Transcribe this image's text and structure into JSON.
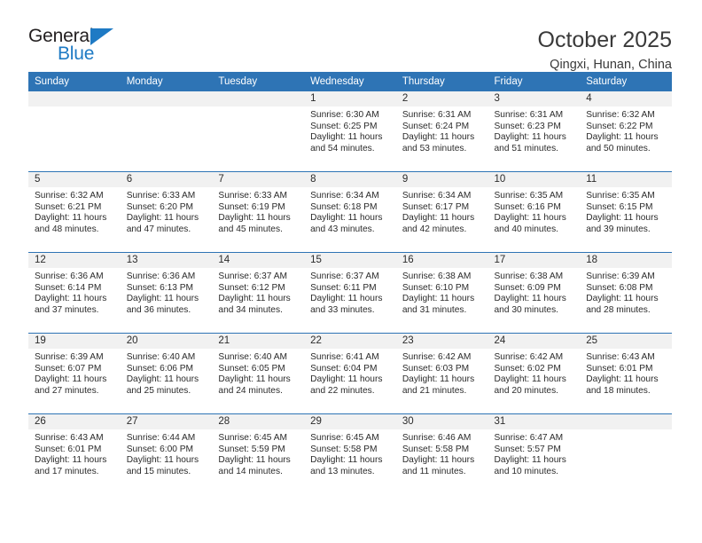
{
  "brand": {
    "name_part1": "General",
    "name_part2": "Blue",
    "triangle_icon": "blue-triangle-icon",
    "accent_color": "#1e7ac4"
  },
  "header": {
    "title": "October 2025",
    "subtitle": "Qingxi, Hunan, China",
    "header_bg_color": "#2e74b5",
    "daynum_bg_color": "#f1f1f1"
  },
  "weekday_headers": [
    "Sunday",
    "Monday",
    "Tuesday",
    "Wednesday",
    "Thursday",
    "Friday",
    "Saturday"
  ],
  "weeks": [
    [
      {
        "day": "",
        "blank": true
      },
      {
        "day": "",
        "blank": true
      },
      {
        "day": "",
        "blank": true
      },
      {
        "day": "1",
        "sunrise": "Sunrise: 6:30 AM",
        "sunset": "Sunset: 6:25 PM",
        "daylight1": "Daylight: 11 hours",
        "daylight2": "and 54 minutes."
      },
      {
        "day": "2",
        "sunrise": "Sunrise: 6:31 AM",
        "sunset": "Sunset: 6:24 PM",
        "daylight1": "Daylight: 11 hours",
        "daylight2": "and 53 minutes."
      },
      {
        "day": "3",
        "sunrise": "Sunrise: 6:31 AM",
        "sunset": "Sunset: 6:23 PM",
        "daylight1": "Daylight: 11 hours",
        "daylight2": "and 51 minutes."
      },
      {
        "day": "4",
        "sunrise": "Sunrise: 6:32 AM",
        "sunset": "Sunset: 6:22 PM",
        "daylight1": "Daylight: 11 hours",
        "daylight2": "and 50 minutes."
      }
    ],
    [
      {
        "day": "5",
        "sunrise": "Sunrise: 6:32 AM",
        "sunset": "Sunset: 6:21 PM",
        "daylight1": "Daylight: 11 hours",
        "daylight2": "and 48 minutes."
      },
      {
        "day": "6",
        "sunrise": "Sunrise: 6:33 AM",
        "sunset": "Sunset: 6:20 PM",
        "daylight1": "Daylight: 11 hours",
        "daylight2": "and 47 minutes."
      },
      {
        "day": "7",
        "sunrise": "Sunrise: 6:33 AM",
        "sunset": "Sunset: 6:19 PM",
        "daylight1": "Daylight: 11 hours",
        "daylight2": "and 45 minutes."
      },
      {
        "day": "8",
        "sunrise": "Sunrise: 6:34 AM",
        "sunset": "Sunset: 6:18 PM",
        "daylight1": "Daylight: 11 hours",
        "daylight2": "and 43 minutes."
      },
      {
        "day": "9",
        "sunrise": "Sunrise: 6:34 AM",
        "sunset": "Sunset: 6:17 PM",
        "daylight1": "Daylight: 11 hours",
        "daylight2": "and 42 minutes."
      },
      {
        "day": "10",
        "sunrise": "Sunrise: 6:35 AM",
        "sunset": "Sunset: 6:16 PM",
        "daylight1": "Daylight: 11 hours",
        "daylight2": "and 40 minutes."
      },
      {
        "day": "11",
        "sunrise": "Sunrise: 6:35 AM",
        "sunset": "Sunset: 6:15 PM",
        "daylight1": "Daylight: 11 hours",
        "daylight2": "and 39 minutes."
      }
    ],
    [
      {
        "day": "12",
        "sunrise": "Sunrise: 6:36 AM",
        "sunset": "Sunset: 6:14 PM",
        "daylight1": "Daylight: 11 hours",
        "daylight2": "and 37 minutes."
      },
      {
        "day": "13",
        "sunrise": "Sunrise: 6:36 AM",
        "sunset": "Sunset: 6:13 PM",
        "daylight1": "Daylight: 11 hours",
        "daylight2": "and 36 minutes."
      },
      {
        "day": "14",
        "sunrise": "Sunrise: 6:37 AM",
        "sunset": "Sunset: 6:12 PM",
        "daylight1": "Daylight: 11 hours",
        "daylight2": "and 34 minutes."
      },
      {
        "day": "15",
        "sunrise": "Sunrise: 6:37 AM",
        "sunset": "Sunset: 6:11 PM",
        "daylight1": "Daylight: 11 hours",
        "daylight2": "and 33 minutes."
      },
      {
        "day": "16",
        "sunrise": "Sunrise: 6:38 AM",
        "sunset": "Sunset: 6:10 PM",
        "daylight1": "Daylight: 11 hours",
        "daylight2": "and 31 minutes."
      },
      {
        "day": "17",
        "sunrise": "Sunrise: 6:38 AM",
        "sunset": "Sunset: 6:09 PM",
        "daylight1": "Daylight: 11 hours",
        "daylight2": "and 30 minutes."
      },
      {
        "day": "18",
        "sunrise": "Sunrise: 6:39 AM",
        "sunset": "Sunset: 6:08 PM",
        "daylight1": "Daylight: 11 hours",
        "daylight2": "and 28 minutes."
      }
    ],
    [
      {
        "day": "19",
        "sunrise": "Sunrise: 6:39 AM",
        "sunset": "Sunset: 6:07 PM",
        "daylight1": "Daylight: 11 hours",
        "daylight2": "and 27 minutes."
      },
      {
        "day": "20",
        "sunrise": "Sunrise: 6:40 AM",
        "sunset": "Sunset: 6:06 PM",
        "daylight1": "Daylight: 11 hours",
        "daylight2": "and 25 minutes."
      },
      {
        "day": "21",
        "sunrise": "Sunrise: 6:40 AM",
        "sunset": "Sunset: 6:05 PM",
        "daylight1": "Daylight: 11 hours",
        "daylight2": "and 24 minutes."
      },
      {
        "day": "22",
        "sunrise": "Sunrise: 6:41 AM",
        "sunset": "Sunset: 6:04 PM",
        "daylight1": "Daylight: 11 hours",
        "daylight2": "and 22 minutes."
      },
      {
        "day": "23",
        "sunrise": "Sunrise: 6:42 AM",
        "sunset": "Sunset: 6:03 PM",
        "daylight1": "Daylight: 11 hours",
        "daylight2": "and 21 minutes."
      },
      {
        "day": "24",
        "sunrise": "Sunrise: 6:42 AM",
        "sunset": "Sunset: 6:02 PM",
        "daylight1": "Daylight: 11 hours",
        "daylight2": "and 20 minutes."
      },
      {
        "day": "25",
        "sunrise": "Sunrise: 6:43 AM",
        "sunset": "Sunset: 6:01 PM",
        "daylight1": "Daylight: 11 hours",
        "daylight2": "and 18 minutes."
      }
    ],
    [
      {
        "day": "26",
        "sunrise": "Sunrise: 6:43 AM",
        "sunset": "Sunset: 6:01 PM",
        "daylight1": "Daylight: 11 hours",
        "daylight2": "and 17 minutes."
      },
      {
        "day": "27",
        "sunrise": "Sunrise: 6:44 AM",
        "sunset": "Sunset: 6:00 PM",
        "daylight1": "Daylight: 11 hours",
        "daylight2": "and 15 minutes."
      },
      {
        "day": "28",
        "sunrise": "Sunrise: 6:45 AM",
        "sunset": "Sunset: 5:59 PM",
        "daylight1": "Daylight: 11 hours",
        "daylight2": "and 14 minutes."
      },
      {
        "day": "29",
        "sunrise": "Sunrise: 6:45 AM",
        "sunset": "Sunset: 5:58 PM",
        "daylight1": "Daylight: 11 hours",
        "daylight2": "and 13 minutes."
      },
      {
        "day": "30",
        "sunrise": "Sunrise: 6:46 AM",
        "sunset": "Sunset: 5:58 PM",
        "daylight1": "Daylight: 11 hours",
        "daylight2": "and 11 minutes."
      },
      {
        "day": "31",
        "sunrise": "Sunrise: 6:47 AM",
        "sunset": "Sunset: 5:57 PM",
        "daylight1": "Daylight: 11 hours",
        "daylight2": "and 10 minutes."
      },
      {
        "day": "",
        "blank": true
      }
    ]
  ]
}
